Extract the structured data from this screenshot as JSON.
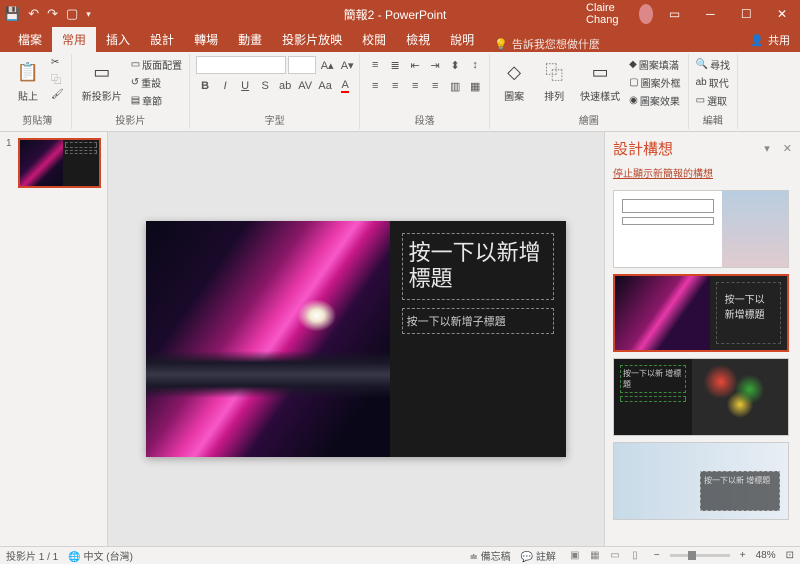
{
  "titlebar": {
    "doc": "簡報2 - PowerPoint",
    "user": "Claire Chang"
  },
  "tabs": {
    "file": "檔案",
    "home": "常用",
    "insert": "插入",
    "design": "設計",
    "trans": "轉場",
    "anim": "動畫",
    "slideshow": "投影片放映",
    "review": "校閱",
    "view": "檢視",
    "help": "說明",
    "tell": "告訴我您想做什麼",
    "share": "共用"
  },
  "ribbon": {
    "clipboard": {
      "label": "剪貼簿",
      "paste": "貼上"
    },
    "slides": {
      "label": "投影片",
      "new": "新投影片",
      "layout": "版面配置",
      "reset": "重設",
      "section": "章節"
    },
    "font": {
      "label": "字型"
    },
    "paragraph": {
      "label": "段落"
    },
    "drawing": {
      "label": "繪圖",
      "shapes": "圖案",
      "arrange": "排列",
      "quick": "快速樣式",
      "fill": "圖案填滿",
      "outline": "圖案外框",
      "effects": "圖案效果"
    },
    "editing": {
      "label": "編輯",
      "find": "尋找",
      "replace": "取代",
      "select": "選取"
    }
  },
  "slide": {
    "title": "按一下以新增標題",
    "subtitle": "按一下以新增子標題"
  },
  "design_ideas": {
    "title": "設計構想",
    "stop_link": "停止顯示新簡報的構想",
    "idea_title": "按一下以新增標題",
    "idea_title_short": "按一下以新 增標題"
  },
  "status": {
    "slide": "投影片 1 / 1",
    "lang": "中文 (台灣)",
    "notes": "備忘稿",
    "comments": "註解",
    "zoom": "48%"
  }
}
